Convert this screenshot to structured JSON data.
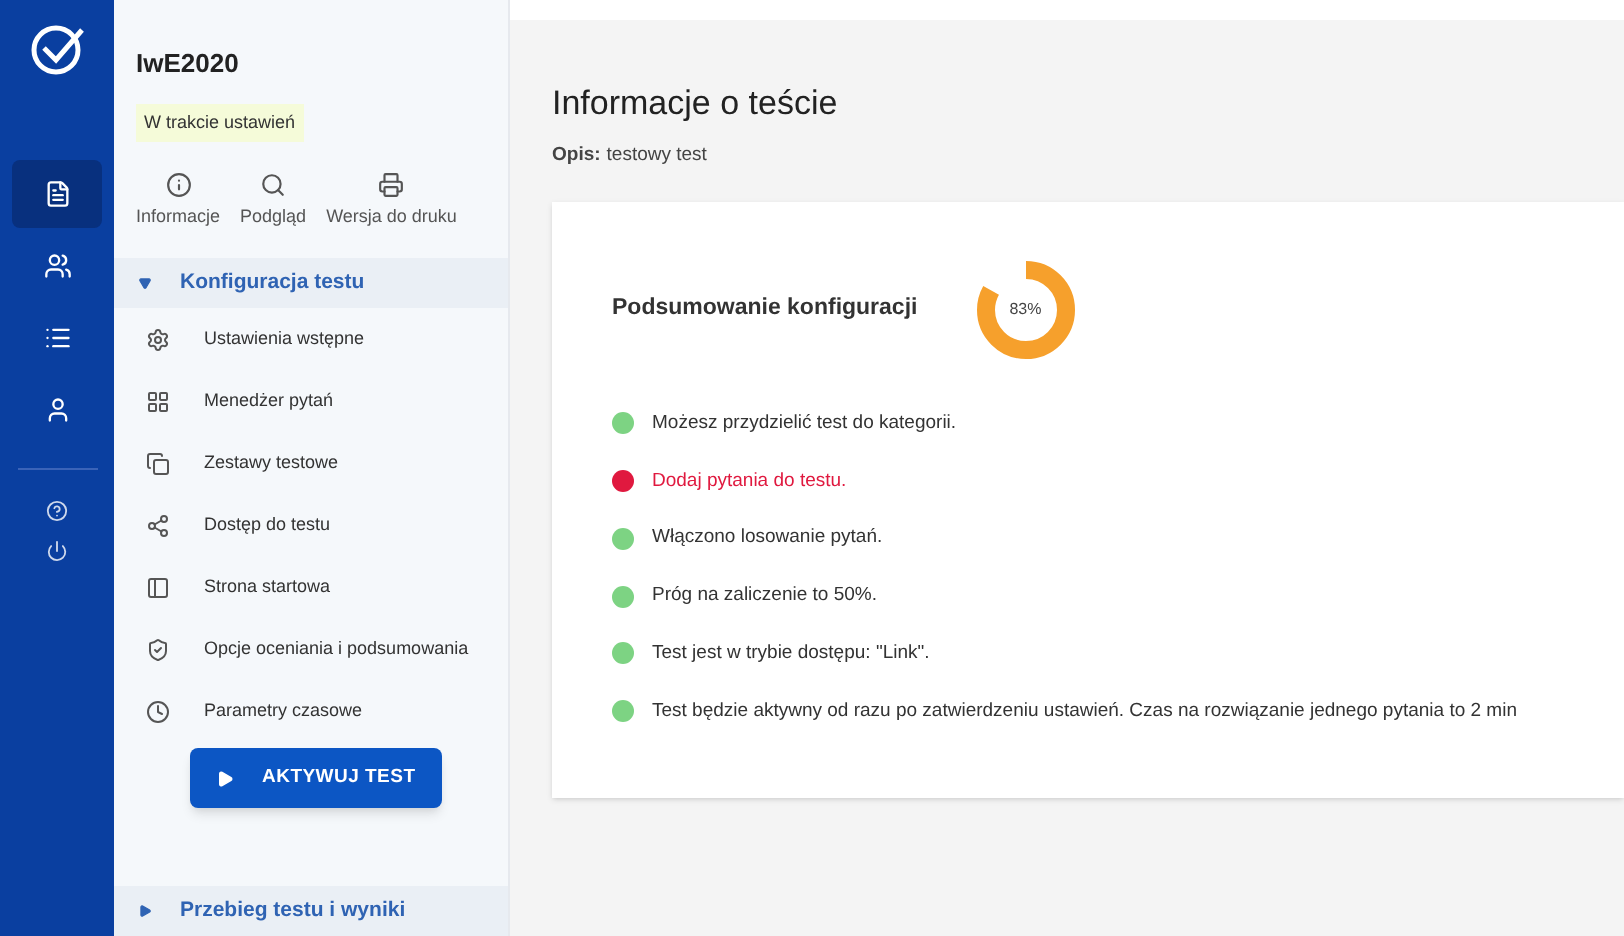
{
  "rail": {
    "items": [
      {
        "selected": true
      },
      {
        "selected": false
      },
      {
        "selected": false
      },
      {
        "selected": false
      }
    ]
  },
  "sidebar": {
    "title": "IwE2020",
    "status_badge": "W trakcie ustawień",
    "actions": [
      "Informacje",
      "Podgląd",
      "Wersja do druku"
    ],
    "sections": [
      {
        "label": "Konfiguracja testu",
        "expanded": true,
        "items": [
          "Ustawienia wstępne",
          "Menedżer pytań",
          "Zestawy testowe",
          "Dostęp do testu",
          "Strona startowa",
          "Opcje oceniania i podsumowania",
          "Parametry czasowe"
        ],
        "button": "AKTYWUJ TEST"
      },
      {
        "label": "Przebieg testu i wyniki",
        "expanded": false
      }
    ]
  },
  "main": {
    "title": "Informacje o teście",
    "description_label": "Opis:",
    "description": "testowy test",
    "summary": {
      "title": "Podsumowanie konfiguracji",
      "percent": "83%",
      "items": [
        {
          "kind": "ok",
          "color": "#7dd383",
          "text": "Możesz przydzielić test do kategorii."
        },
        {
          "kind": "error",
          "color": "#e0193f",
          "text": "Dodaj pytania do testu."
        },
        {
          "kind": "ok",
          "color": "#7dd383",
          "text": "Włączono losowanie pytań."
        },
        {
          "kind": "ok",
          "color": "#7dd383",
          "text": "Próg na zaliczenie to 50%."
        },
        {
          "kind": "ok",
          "color": "#7dd383",
          "text": "Test jest w trybie dostępu: \"Link\"."
        },
        {
          "kind": "ok",
          "color": "#7dd383",
          "text": "Test będzie aktywny od razu po zatwierdzeniu ustawień. Czas na rozwiązanie jednego pytania to 2 min"
        }
      ]
    }
  }
}
